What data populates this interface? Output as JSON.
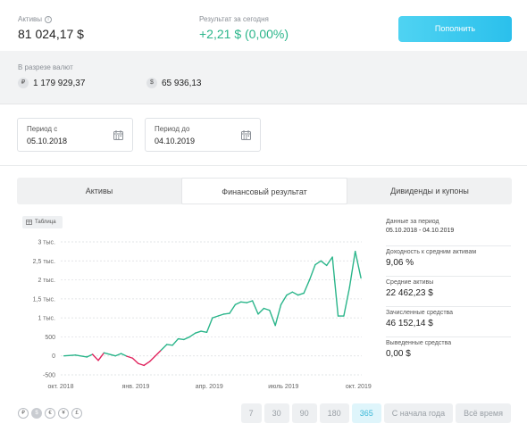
{
  "header": {
    "assets_label": "Активы",
    "assets_value": "81 024,17 $",
    "result_label": "Результат за сегодня",
    "result_value": "+2,21 $  (0,00%)",
    "topup_label": "Пополнить"
  },
  "currencies": {
    "label": "В разрезе валют",
    "items": [
      {
        "symbol": "₽",
        "value": "1 179 929,37"
      },
      {
        "symbol": "$",
        "value": "65 936,13"
      }
    ]
  },
  "period": {
    "from_label": "Период с",
    "from_value": "05.10.2018",
    "to_label": "Период до",
    "to_value": "04.10.2019"
  },
  "tabs": [
    "Активы",
    "Финансовый результат",
    "Дивиденды и купоны"
  ],
  "active_tab": 1,
  "table_button": "Таблица",
  "stats": [
    {
      "label": "Данные за период",
      "value": "05.10.2018 - 04.10.2019"
    },
    {
      "label": "Доходность к средним активам",
      "value": "9,06 %"
    },
    {
      "label": "Средние активы",
      "value": "22 462,23 $"
    },
    {
      "label": "Зачисленные средства",
      "value": "46 152,14 $"
    },
    {
      "label": "Выведенные средства",
      "value": "0,00 $"
    }
  ],
  "currency_icons": [
    "₽",
    "$",
    "€",
    "¥",
    "£"
  ],
  "active_currency": 1,
  "ranges": [
    "7",
    "30",
    "90",
    "180",
    "365",
    "С начала года",
    "Всё время"
  ],
  "active_range": 4,
  "colors": {
    "positive": "#2ab58a",
    "negative": "#e0245e",
    "accent": "#2bc0ec"
  },
  "chart_data": {
    "type": "line",
    "y_ticks": [
      "3 тыс.",
      "2,5 тыс.",
      "2 тыс.",
      "1,5 тыс.",
      "1 тыс.",
      "500",
      "0",
      "-500"
    ],
    "x_ticks": [
      "окт. 2018",
      "янв. 2019",
      "апр. 2019",
      "июль 2019",
      "окт. 2019"
    ],
    "ylim": [
      -500,
      3000
    ],
    "x": [
      "2018-10-05",
      "2018-10-19",
      "2018-11-02",
      "2018-11-09",
      "2018-11-16",
      "2018-11-23",
      "2018-12-07",
      "2018-12-14",
      "2018-12-21",
      "2018-12-28",
      "2019-01-04",
      "2019-01-11",
      "2019-01-18",
      "2019-02-01",
      "2019-02-08",
      "2019-02-15",
      "2019-02-22",
      "2019-03-01",
      "2019-03-08",
      "2019-03-15",
      "2019-03-22",
      "2019-03-29",
      "2019-04-05",
      "2019-04-12",
      "2019-04-19",
      "2019-04-26",
      "2019-05-03",
      "2019-05-10",
      "2019-05-17",
      "2019-05-24",
      "2019-05-31",
      "2019-06-07",
      "2019-06-14",
      "2019-06-21",
      "2019-06-28",
      "2019-07-05",
      "2019-07-12",
      "2019-07-19",
      "2019-07-26",
      "2019-08-02",
      "2019-08-09",
      "2019-08-16",
      "2019-08-23",
      "2019-08-30",
      "2019-09-06",
      "2019-09-13",
      "2019-09-20",
      "2019-09-27",
      "2019-10-04"
    ],
    "values": [
      0,
      20,
      -30,
      40,
      -120,
      80,
      0,
      60,
      -10,
      -60,
      -200,
      -250,
      -150,
      150,
      300,
      280,
      450,
      430,
      500,
      600,
      650,
      620,
      1000,
      1050,
      1100,
      1120,
      1350,
      1420,
      1400,
      1450,
      1100,
      1250,
      1200,
      800,
      1350,
      1600,
      1680,
      1600,
      1650,
      2000,
      2400,
      2500,
      2380,
      2600,
      1050,
      1050,
      1800,
      2750,
      2050
    ]
  }
}
